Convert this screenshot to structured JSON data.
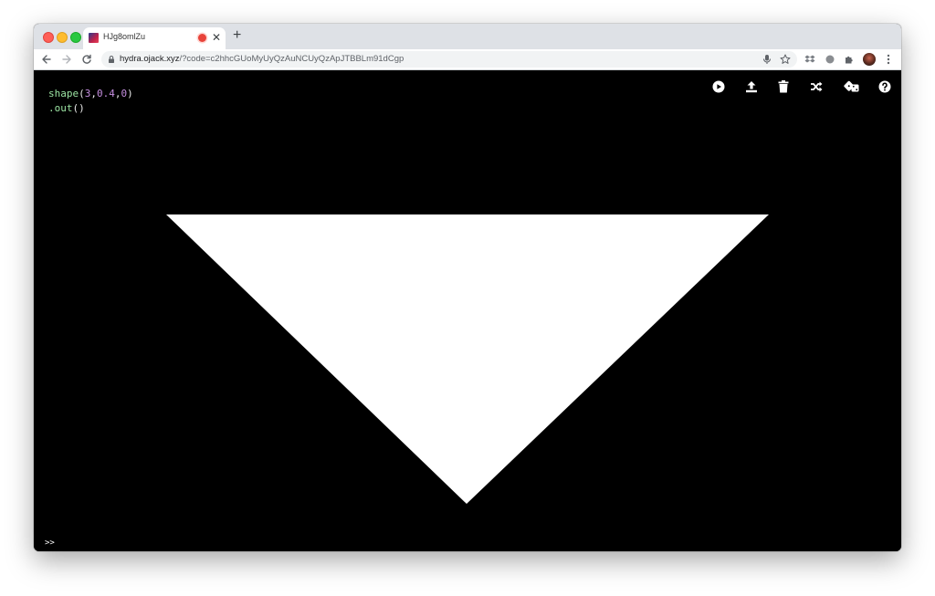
{
  "browser": {
    "tab_title": "HJg8omlZu",
    "url_host": "hydra.ojack.xyz",
    "url_path": "/?code=c2hhcGUoMyUyQzAuNCUyQzApJTBBLm91dCgp"
  },
  "editor": {
    "line1": {
      "fn": "shape",
      "open": "(",
      "arg1": "3",
      "comma1": ",",
      "arg2": "0.4",
      "comma2": ",",
      "arg3": "0",
      "close": ")"
    },
    "line2": {
      "fn": ".out",
      "parens": "()"
    }
  },
  "console": {
    "prompt": ">>"
  },
  "icons": {
    "hydra_toolbar": [
      "play-icon",
      "upload-icon",
      "trash-icon",
      "shuffle-icon",
      "dice-icon",
      "help-icon"
    ]
  },
  "colors": {
    "background": "#000000",
    "shape_fill": "#ffffff",
    "code_function": "#9be3a2",
    "code_number": "#c58ee0"
  }
}
